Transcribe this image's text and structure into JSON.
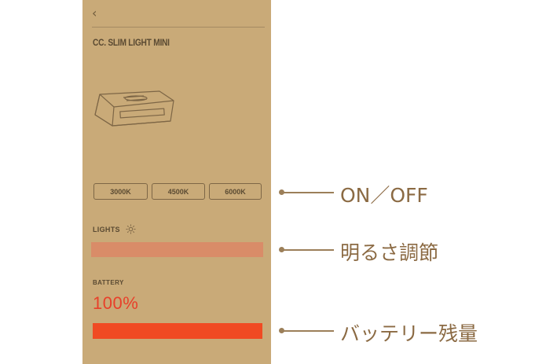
{
  "app": {
    "back_icon": "chevron-left-icon",
    "title": "CC. SLIM LIGHT MINI"
  },
  "color_temps": [
    {
      "label": "3000K"
    },
    {
      "label": "4500K"
    },
    {
      "label": "6000K"
    }
  ],
  "lights": {
    "label": "LIGHTS",
    "icon": "sun-icon",
    "brightness_level": 1.0,
    "bar_color": "#d98c68"
  },
  "battery": {
    "label": "BATTERY",
    "percent_text": "100%",
    "level": 1.0,
    "bar_color": "#f04a23"
  },
  "callouts": {
    "on_off": "ON／OFF",
    "brightness": "明るさ調節",
    "battery": "バッテリー残量"
  },
  "colors": {
    "panel": "#c9aa78",
    "accent": "#f04a23",
    "callout": "#8b6a43"
  }
}
